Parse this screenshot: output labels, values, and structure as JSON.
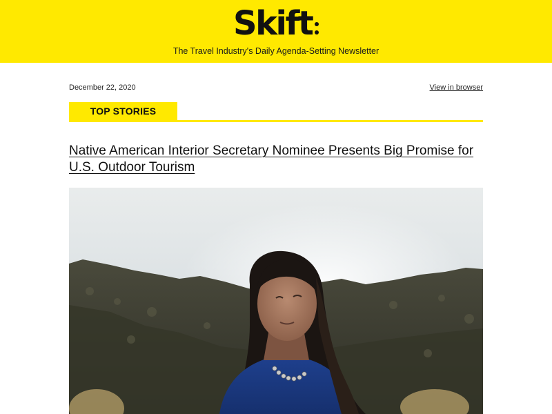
{
  "brand": {
    "logo_text": "Skift",
    "tagline": "The Travel Industry's Daily Agenda-Setting Newsletter",
    "color": "#ffe900"
  },
  "meta": {
    "date": "December 22, 2020",
    "view_in_browser": "View in browser"
  },
  "section": {
    "label": "TOP STORIES"
  },
  "story": {
    "headline": "Native American Interior Secretary Nominee Presents Big Promise for U.S. Outdoor Tourism",
    "image_description": "photo-of-woman-outdoors-in-mountains"
  }
}
